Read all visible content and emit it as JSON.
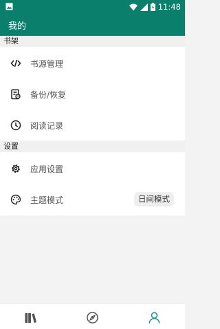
{
  "status_bar": {
    "time": "11:48",
    "icons": [
      "image-icon",
      "wifi-icon",
      "signal-icon",
      "battery-icon"
    ]
  },
  "app_bar": {
    "title": "我的"
  },
  "sections": {
    "bookshelf": {
      "header": "书架",
      "items": [
        {
          "label": "书源管理",
          "icon": "code-icon"
        },
        {
          "label": "备份/恢复",
          "icon": "backup-icon"
        },
        {
          "label": "阅读记录",
          "icon": "clock-icon"
        }
      ]
    },
    "settings": {
      "header": "设置",
      "items": [
        {
          "label": "应用设置",
          "icon": "gear-icon"
        },
        {
          "label": "主题模式",
          "icon": "palette-icon",
          "value": "日间模式"
        }
      ]
    }
  },
  "bottom_nav": {
    "items": [
      {
        "name": "bookshelf",
        "icon": "books-icon",
        "active": false
      },
      {
        "name": "discover",
        "icon": "compass-icon",
        "active": false
      },
      {
        "name": "mine",
        "icon": "person-icon",
        "active": true
      }
    ]
  },
  "colors": {
    "primary": "#0a806c",
    "active_nav": "#16958a",
    "inactive_nav": "#555555"
  }
}
